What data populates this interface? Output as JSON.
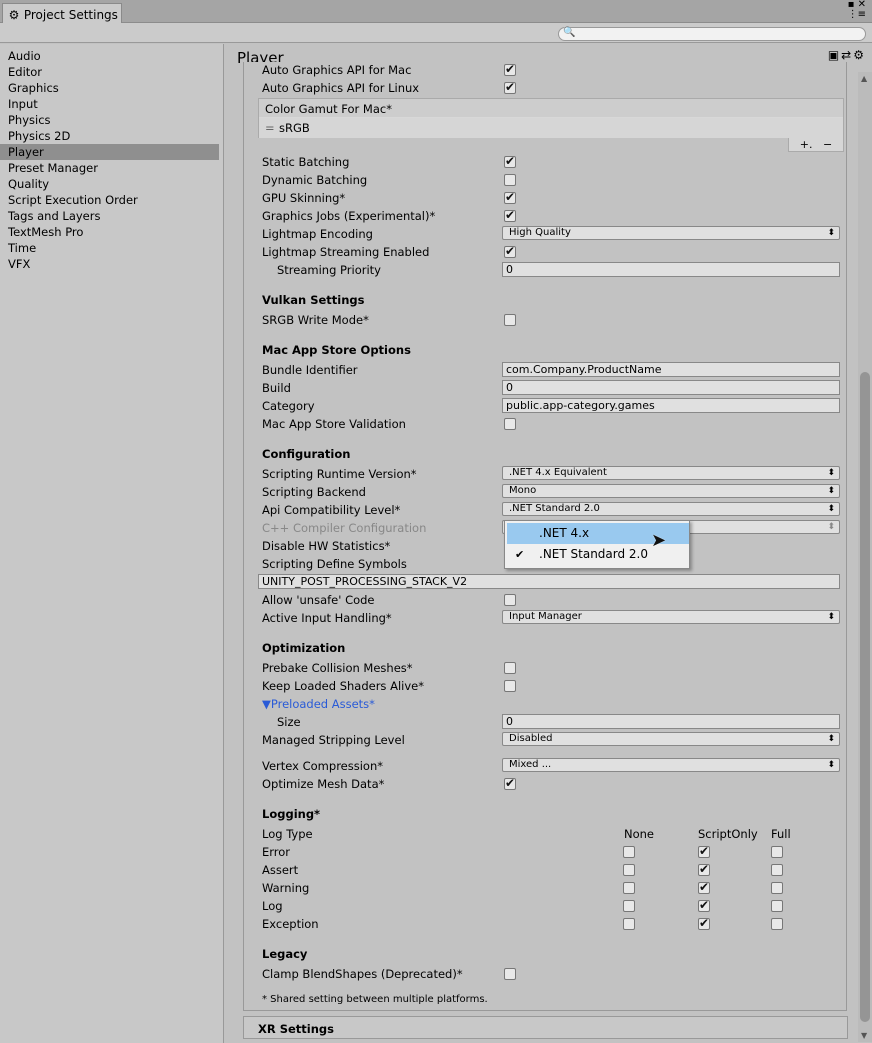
{
  "window": {
    "tab_title": "Project Settings",
    "tab_icon": "gear-icon"
  },
  "sidebar": {
    "items": [
      "Audio",
      "Editor",
      "Graphics",
      "Input",
      "Physics",
      "Physics 2D",
      "Player",
      "Preset Manager",
      "Quality",
      "Script Execution Order",
      "Tags and Layers",
      "TextMesh Pro",
      "Time",
      "VFX"
    ],
    "selected": "Player"
  },
  "main": {
    "title": "Player"
  },
  "graphics": {
    "auto_mac": "Auto Graphics API  for Mac",
    "auto_linux": "Auto Graphics API  for Linux",
    "gamut_title": "Color Gamut For Mac*",
    "gamut_item": "sRGB",
    "static_batching": "Static Batching",
    "dynamic_batching": "Dynamic Batching",
    "gpu_skinning": "GPU Skinning*",
    "graphics_jobs": "Graphics Jobs (Experimental)*",
    "lightmap_encoding": "Lightmap Encoding",
    "lightmap_encoding_value": "High Quality",
    "lightmap_streaming": "Lightmap Streaming Enabled",
    "streaming_priority": "Streaming Priority",
    "streaming_priority_value": "0"
  },
  "vulkan": {
    "header": "Vulkan Settings",
    "srgb": "SRGB Write Mode*"
  },
  "mac_store": {
    "header": "Mac App Store Options",
    "bundle_label": "Bundle Identifier",
    "bundle_value": "com.Company.ProductName",
    "build_label": "Build",
    "build_value": "0",
    "category_label": "Category",
    "category_value": "public.app-category.games",
    "validation_label": "Mac App Store Validation"
  },
  "configuration": {
    "header": "Configuration",
    "runtime_label": "Scripting Runtime Version*",
    "runtime_value": ".NET 4.x Equivalent",
    "backend_label": "Scripting Backend",
    "backend_value": "Mono",
    "api_label": "Api Compatibility Level*",
    "api_value": ".NET Standard 2.0",
    "cpp_label": "C++ Compiler Configuration",
    "hw_stats_label": "Disable HW Statistics*",
    "define_label": "Scripting Define Symbols",
    "define_value": "UNITY_POST_PROCESSING_STACK_V2",
    "unsafe_label": "Allow 'unsafe' Code",
    "input_label": "Active Input Handling*",
    "input_value": "Input Manager"
  },
  "popup": {
    "option1": ".NET 4.x",
    "option2": ".NET Standard 2.0"
  },
  "optimization": {
    "header": "Optimization",
    "prebake": "Prebake Collision Meshes*",
    "keep_shaders": "Keep Loaded Shaders Alive*",
    "preloaded": "Preloaded Assets*",
    "size_label": "Size",
    "size_value": "0",
    "stripping_label": "Managed Stripping Level",
    "stripping_value": "Disabled",
    "vertex_label": "Vertex Compression*",
    "vertex_value": "Mixed ...",
    "optimize_mesh": "Optimize Mesh Data*"
  },
  "logging": {
    "header": "Logging*",
    "col_type": "Log Type",
    "col_none": "None",
    "col_script": "ScriptOnly",
    "col_full": "Full",
    "rows": [
      "Error",
      "Assert",
      "Warning",
      "Log",
      "Exception"
    ]
  },
  "legacy": {
    "header": "Legacy",
    "clamp": "Clamp BlendShapes (Deprecated)*",
    "footnote": "* Shared setting between multiple platforms."
  },
  "xr": {
    "header": "XR Settings"
  }
}
